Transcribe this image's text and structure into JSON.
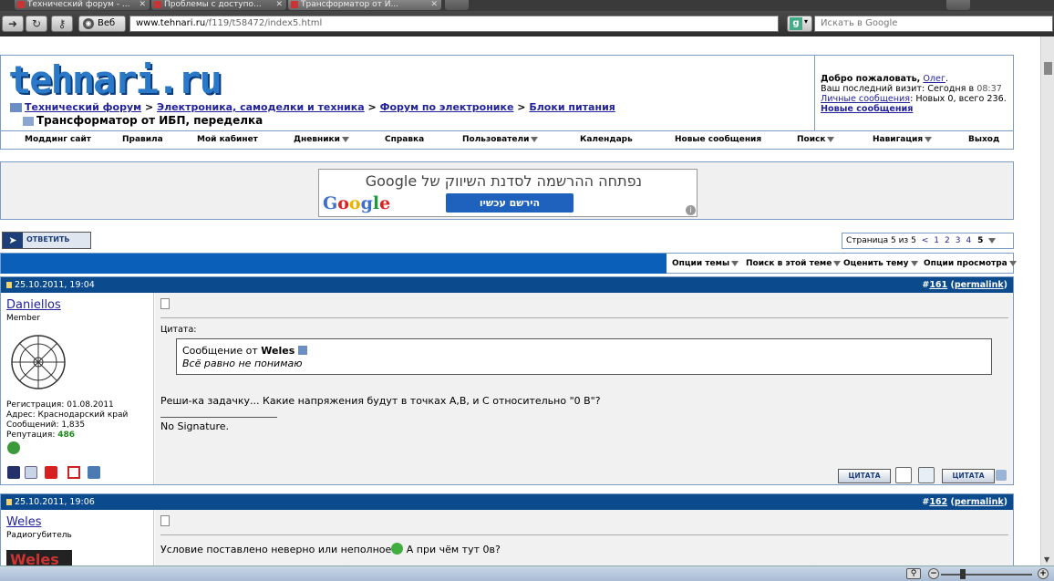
{
  "browser": {
    "tabs": [
      {
        "label": "Технический форум - ..."
      },
      {
        "label": "Проблемы с доступо..."
      },
      {
        "label": "Трансформатор от И..."
      }
    ],
    "web_button": "Веб",
    "url_domain": "www.tehnari.ru",
    "url_path": "/f119/t58472/index5.html",
    "search_placeholder": "Искать в Google",
    "search_engine_icon": "google-g-icon"
  },
  "site": {
    "logo": "tehnari.ru",
    "breadcrumb": [
      "Технический форум",
      "Электроника, самоделки и техника",
      "Форум по электронике",
      "Блоки питания"
    ],
    "separator": ">",
    "thread_title": "Трансформатор от ИБП, переделка",
    "welcome": {
      "greeting": "Добро пожаловать,",
      "user": "Олег",
      "last_visit_label": "Ваш последний визит: Сегодня в",
      "last_visit_time": "08:37",
      "pm_label": "Личные сообщения",
      "pm_stats": ": Новых 0, всего 236.",
      "new_posts": "Новые сообщения"
    },
    "nav": [
      "Моддинг сайт",
      "Правила",
      "Мой кабинет",
      "Дневники",
      "Справка",
      "Пользователи",
      "Календарь",
      "Новые сообщения",
      "Поиск",
      "Навигация",
      "Выход"
    ]
  },
  "ad": {
    "headline": "נפתחה ההרשמה לסדנת השיווק של Google",
    "button": "הירשם עכשיו",
    "logo": "Google"
  },
  "thread": {
    "reply_label": "ОТВЕТИТЬ",
    "pager": {
      "label": "Страница 5 из 5",
      "prev": "<",
      "pages": [
        "1",
        "2",
        "3",
        "4"
      ],
      "current": "5"
    },
    "options": [
      "Опции темы",
      "Поиск в этой теме",
      "Оценить тему",
      "Опции просмотра"
    ]
  },
  "posts": [
    {
      "date": "25.10.2011, 19:04",
      "number": "161",
      "permalink": "permalink",
      "username": "Daniellos",
      "user_title": "Member",
      "reg": "Регистрация: 01.08.2011",
      "addr": "Адрес: Краснодарский край",
      "count": "Сообщений: 1,835",
      "rep_label": "Репутация:",
      "rep_value": "486",
      "quote_header": "Цитата:",
      "quote_from_label": "Сообщение от",
      "quote_author": "Weles",
      "quote_text": "Всё равно не понимаю",
      "text": "Реши-ка задачку... Какие напряжения будут в точках А,В, и С относительно \"0 В\"?",
      "signature": "No Signature.",
      "quote_btn": "ЦИТАТА",
      "multiquote_btn": "ЦИТАТА"
    },
    {
      "date": "25.10.2011, 19:06",
      "number": "162",
      "permalink": "permalink",
      "username": "Weles",
      "user_title": "Радиогубитель",
      "avatar_text": "Weles",
      "text_before": "Условие поставлено неверно или неполное",
      "text_after": " А при чём тут 0в?"
    }
  ],
  "colors": {
    "header_blue": "#0b4a8c",
    "bar_blue": "#0a60b8",
    "link": "#22229c",
    "reputation": "#1a8a1a",
    "logo_blue": "#2a79c9"
  }
}
